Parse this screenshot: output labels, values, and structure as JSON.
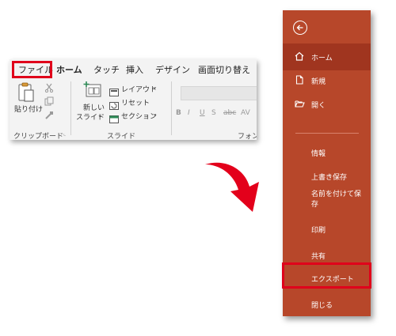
{
  "ribbon": {
    "tabs": [
      "ファイル",
      "ホーム",
      "タッチ",
      "挿入",
      "デザイン",
      "画面切り替え"
    ],
    "clipboard": {
      "paste_label": "貼り付け",
      "group_label": "クリップボード"
    },
    "slides": {
      "new_slide_line1": "新しい",
      "new_slide_line2": "スライド",
      "layout": "レイアウト",
      "reset": "リセット",
      "section": "セクション",
      "group_label": "スライド"
    },
    "font": {
      "bold": "B",
      "italic": "I",
      "underline": "U",
      "strike": "S",
      "abc": "abc",
      "spacing": "AV",
      "group_label": "フォン"
    }
  },
  "backstage": {
    "items": [
      {
        "label": "ホーム",
        "icon": "home-icon"
      },
      {
        "label": "新規",
        "icon": "new-document-icon"
      },
      {
        "label": "開く",
        "icon": "open-folder-icon"
      },
      {
        "label": "情報"
      },
      {
        "label": "上書き保存"
      },
      {
        "label": "名前を付けて保存"
      },
      {
        "label": "印刷"
      },
      {
        "label": "共有"
      },
      {
        "label": "エクスポート"
      },
      {
        "label": "閉じる"
      }
    ],
    "saveas_line1": "名前を付けて保",
    "saveas_line2": "存"
  },
  "colors": {
    "panel": "#b7472a",
    "active_item": "#a0351f",
    "highlight": "#e0001b",
    "arrow": "#e3001b"
  }
}
